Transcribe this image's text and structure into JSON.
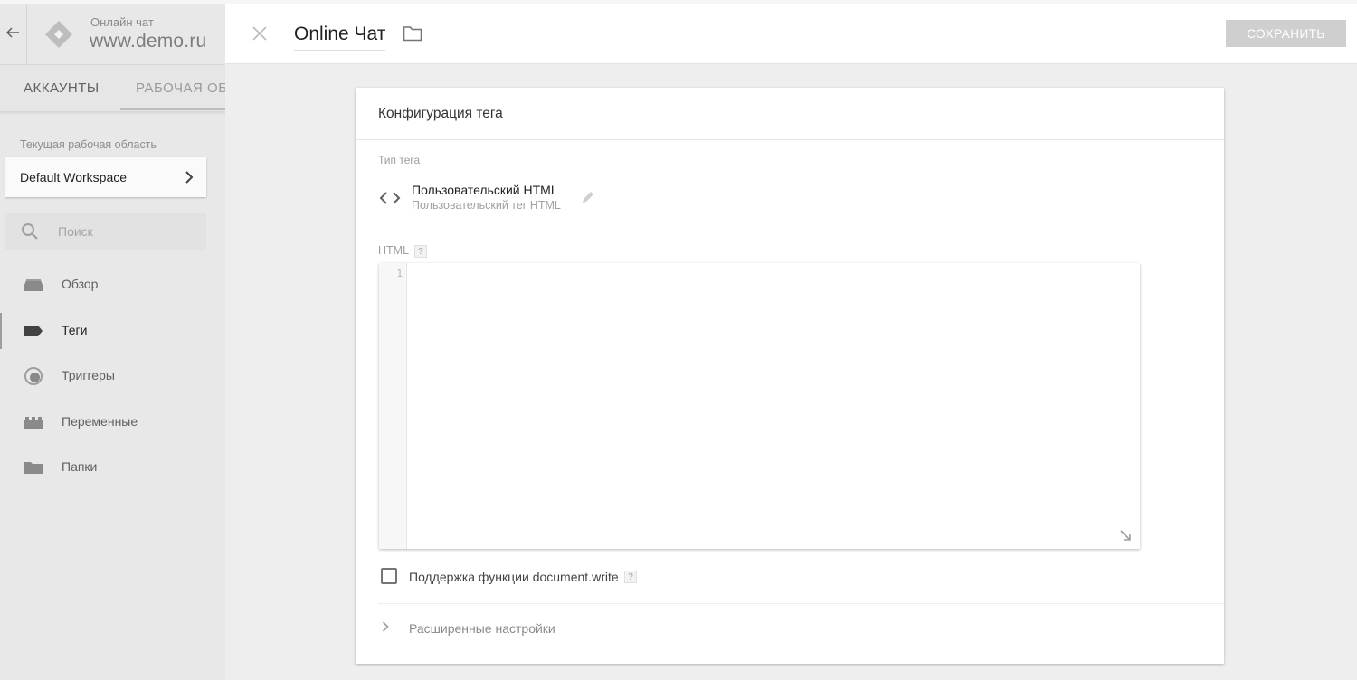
{
  "header": {
    "container_subtitle": "Онлайн чат",
    "container_name": "www.demo.ru"
  },
  "tabs": [
    {
      "label": "АККАУНТЫ"
    },
    {
      "label": "РАБОЧАЯ ОБЛ"
    }
  ],
  "workspace": {
    "label": "Текущая рабочая область",
    "name": "Default Workspace"
  },
  "search": {
    "placeholder": "Поиск"
  },
  "nav": {
    "items": [
      {
        "label": "Обзор",
        "icon": "overview-icon"
      },
      {
        "label": "Теги",
        "icon": "tag-icon",
        "active": true
      },
      {
        "label": "Триггеры",
        "icon": "trigger-icon"
      },
      {
        "label": "Переменные",
        "icon": "variables-icon"
      },
      {
        "label": "Папки",
        "icon": "folder-icon"
      }
    ]
  },
  "toolbar": {
    "tag_name": "Online Чат",
    "save_label": "СОХРАНИТЬ"
  },
  "card": {
    "title": "Конфигурация тега",
    "tag_type_label": "Тип тега",
    "tag_type_title": "Пользовательский HTML",
    "tag_type_subtitle": "Пользовательский тег HTML",
    "html_label": "HTML",
    "help_glyph": "?",
    "line_number": "1",
    "code_value": "",
    "docwrite_label": "Поддержка функции document.write",
    "docwrite_checked": false,
    "advanced_label": "Расширенные настройки"
  },
  "colors": {
    "save_button_bg": "#cfcfcf",
    "sidebar_bg": "#e8e8e8",
    "main_bg": "#eeeeee"
  }
}
